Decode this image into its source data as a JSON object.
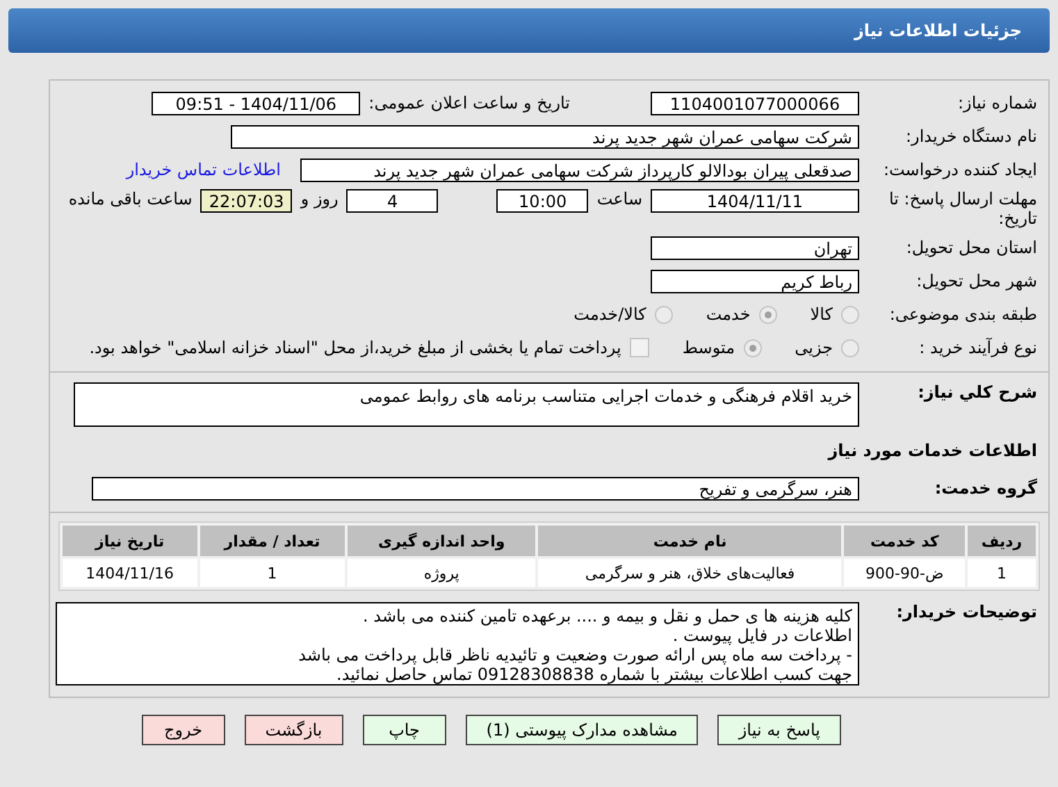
{
  "header": {
    "title": "جزئیات اطلاعات نیاز"
  },
  "fields": {
    "need_number": {
      "label": "شماره نیاز:",
      "value": "1104001077000066"
    },
    "announce": {
      "label": "تاریخ و ساعت اعلان عمومی:",
      "value": "1404/11/06 - 09:51"
    },
    "buyer": {
      "label": "نام دستگاه خریدار:",
      "value": "شرکت سهامی عمران شهر جدید پرند"
    },
    "creator": {
      "label": "ایجاد کننده درخواست:",
      "value": "صدقعلی پیران بودالالو کارپرداز شرکت سهامی عمران شهر جدید پرند",
      "link": "اطلاعات تماس خریدار"
    },
    "deadline": {
      "label": "مهلت ارسال پاسخ: تا تاریخ:",
      "date": "1404/11/11",
      "time_label": "ساعت",
      "time": "10:00",
      "days": "4",
      "days_label": "روز و",
      "remaining": "22:07:03",
      "remaining_label": "ساعت باقی مانده"
    },
    "province": {
      "label": "استان محل تحویل:",
      "value": "تهران"
    },
    "city": {
      "label": "شهر محل تحویل:",
      "value": "رباط کریم"
    }
  },
  "category": {
    "label": "طبقه بندی موضوعی:",
    "options": [
      {
        "label": "کالا",
        "selected": false
      },
      {
        "label": "خدمت",
        "selected": true
      },
      {
        "label": "کالا/خدمت",
        "selected": false
      }
    ]
  },
  "process": {
    "label": "نوع فرآیند خرید :",
    "options": [
      {
        "label": "جزیی",
        "selected": false
      },
      {
        "label": "متوسط",
        "selected": true
      }
    ],
    "treasury": {
      "checked": false,
      "label": "پرداخت تمام یا بخشی از مبلغ خرید،از محل \"اسناد خزانه اسلامی\" خواهد بود."
    }
  },
  "description": {
    "label": "شرح کلي نياز:",
    "value": "خرید اقلام فرهنگی و خدمات اجرایی متناسب برنامه های روابط عمومی"
  },
  "services_heading": "اطلاعات خدمات مورد نیاز",
  "service_group": {
    "label": "گروه خدمت:",
    "value": "هنر، سرگرمی و تفریح"
  },
  "table": {
    "columns": [
      "ردیف",
      "کد خدمت",
      "نام خدمت",
      "واحد اندازه گیری",
      "تعداد / مقدار",
      "تاریخ نیاز"
    ],
    "rows": [
      [
        "1",
        "ض-90-900",
        "فعالیت‌های خلاق، هنر و سرگرمی",
        "پروژه",
        "1",
        "1404/11/16"
      ]
    ]
  },
  "notes": {
    "label": "توضیحات خریدار:",
    "lines": [
      "کلیه هزینه ها ی حمل و نقل و بیمه و .... برعهده تامین کننده می باشد .",
      "اطلاعات در فایل پیوست .",
      "- پرداخت سه ماه پس ارائه صورت وضعیت و تائیدیه ناظر قابل پرداخت می باشد",
      "جهت کسب اطلاعات بیشتر با شماره 09128308838  تماس حاصل نمائید."
    ]
  },
  "buttons": [
    {
      "label": "پاسخ به نیاز",
      "kind": "green"
    },
    {
      "label": "مشاهده مدارک پیوستی (1)",
      "kind": "green"
    },
    {
      "label": "چاپ",
      "kind": "green"
    },
    {
      "label": "بازگشت",
      "kind": "red"
    },
    {
      "label": "خروج",
      "kind": "red"
    }
  ]
}
